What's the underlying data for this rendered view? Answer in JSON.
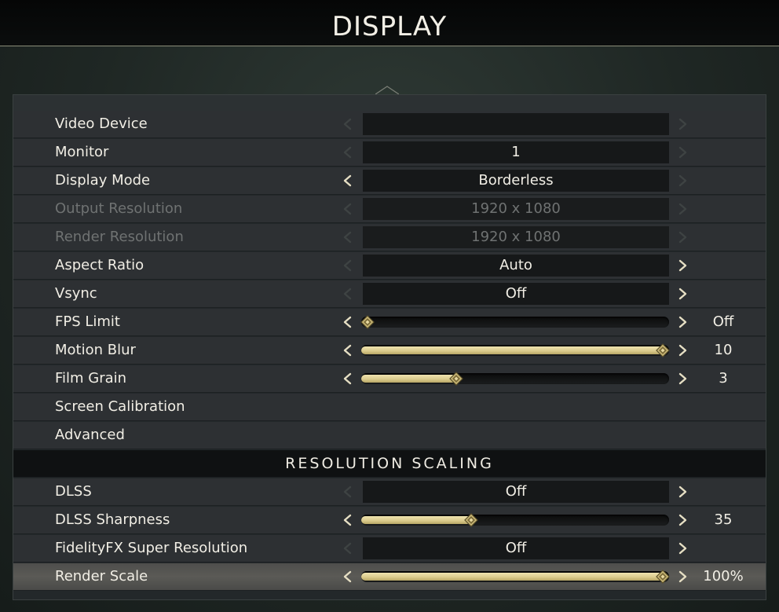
{
  "title": "DISPLAY",
  "colors": {
    "accent": "#d9c98a",
    "active_row": "#55544f",
    "disabled_text": "#6f7272"
  },
  "icons": {
    "left": "chevron-left-icon",
    "right": "chevron-right-icon",
    "knob": "diamond-knob-icon"
  },
  "rows": [
    {
      "id": "video-device",
      "label": "Video Device",
      "type": "select",
      "value": "",
      "left_enabled": false,
      "right_enabled": false,
      "disabled": false
    },
    {
      "id": "monitor",
      "label": "Monitor",
      "type": "select",
      "value": "1",
      "left_enabled": false,
      "right_enabled": false,
      "disabled": false
    },
    {
      "id": "display-mode",
      "label": "Display Mode",
      "type": "select",
      "value": "Borderless",
      "left_enabled": true,
      "right_enabled": false,
      "disabled": false
    },
    {
      "id": "output-resolution",
      "label": "Output Resolution",
      "type": "select",
      "value": "1920 x 1080",
      "left_enabled": false,
      "right_enabled": false,
      "disabled": true
    },
    {
      "id": "render-resolution",
      "label": "Render Resolution",
      "type": "select",
      "value": "1920 x 1080",
      "left_enabled": false,
      "right_enabled": false,
      "disabled": true
    },
    {
      "id": "aspect-ratio",
      "label": "Aspect Ratio",
      "type": "select",
      "value": "Auto",
      "left_enabled": false,
      "right_enabled": true,
      "disabled": false
    },
    {
      "id": "vsync",
      "label": "Vsync",
      "type": "select",
      "value": "Off",
      "left_enabled": false,
      "right_enabled": true,
      "disabled": false
    },
    {
      "id": "fps-limit",
      "label": "FPS Limit",
      "type": "slider",
      "value": "Off",
      "fraction": 0.0,
      "left_enabled": true,
      "right_enabled": true,
      "disabled": false
    },
    {
      "id": "motion-blur",
      "label": "Motion Blur",
      "type": "slider",
      "value": "10",
      "fraction": 1.0,
      "left_enabled": true,
      "right_enabled": true,
      "disabled": false
    },
    {
      "id": "film-grain",
      "label": "Film Grain",
      "type": "slider",
      "value": "3",
      "fraction": 0.3,
      "left_enabled": true,
      "right_enabled": true,
      "disabled": false
    },
    {
      "id": "screen-calibration",
      "label": "Screen Calibration",
      "type": "link",
      "disabled": false
    },
    {
      "id": "advanced",
      "label": "Advanced",
      "type": "link",
      "disabled": false
    }
  ],
  "section": {
    "title": "RESOLUTION SCALING"
  },
  "scaling_rows": [
    {
      "id": "dlss",
      "label": "DLSS",
      "type": "select",
      "value": "Off",
      "left_enabled": false,
      "right_enabled": true,
      "disabled": false
    },
    {
      "id": "dlss-sharpness",
      "label": "DLSS Sharpness",
      "type": "slider",
      "value": "35",
      "fraction": 0.35,
      "left_enabled": true,
      "right_enabled": true,
      "disabled": false
    },
    {
      "id": "fidelityfx-super-resolution",
      "label": "FidelityFX Super Resolution",
      "type": "select",
      "value": "Off",
      "left_enabled": false,
      "right_enabled": true,
      "disabled": false
    },
    {
      "id": "render-scale",
      "label": "Render Scale",
      "type": "slider",
      "value": "100%",
      "fraction": 1.0,
      "left_enabled": true,
      "right_enabled": true,
      "disabled": false,
      "active": true
    }
  ]
}
